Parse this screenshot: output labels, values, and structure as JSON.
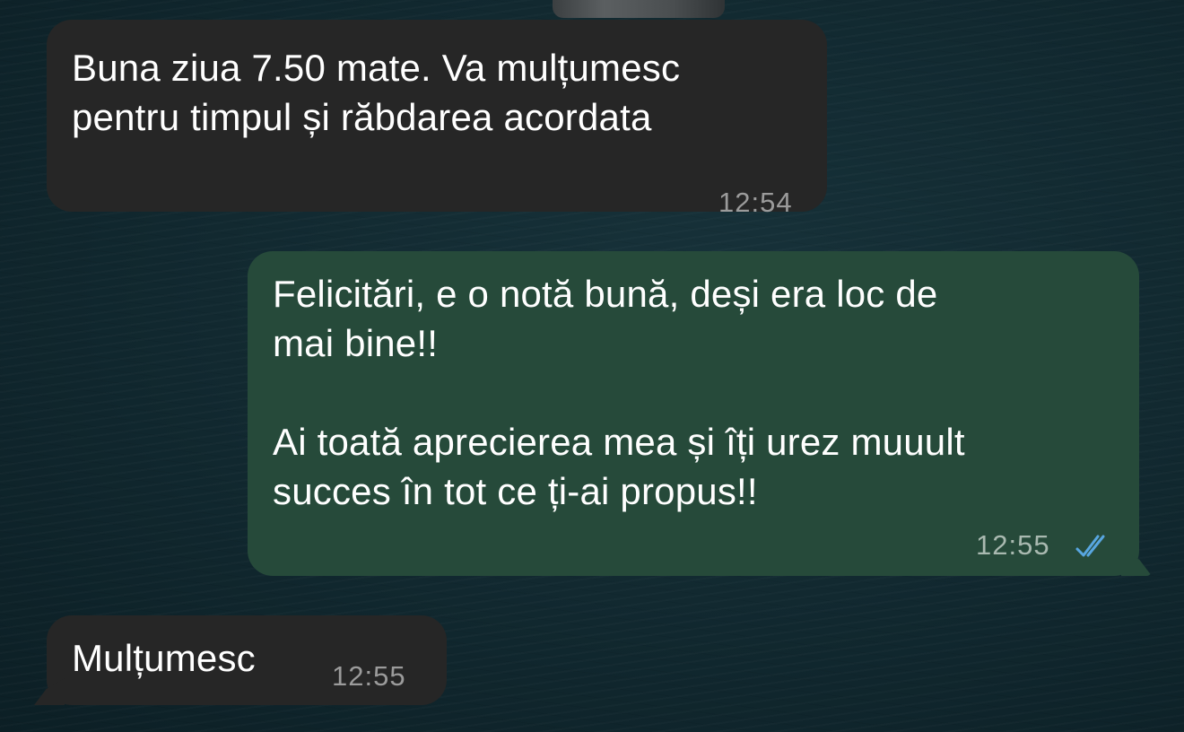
{
  "messages": [
    {
      "direction": "incoming",
      "text": "Buna ziua 7.50 mate. Va mulțumesc\npentru timpul și răbdarea acordata",
      "time": "12:54"
    },
    {
      "direction": "outgoing",
      "text": "Felicitări, e o notă bună, deși era loc de\nmai bine!!\n\nAi toată aprecierea mea și îți urez muuult\nsucces în tot ce ți-ai propus!!",
      "time": "12:55",
      "status": "read",
      "status_icon": "double-check-icon",
      "status_color": "#58a6e0"
    },
    {
      "direction": "incoming",
      "text": "Mulțumesc",
      "time": "12:55"
    }
  ],
  "theme": {
    "incoming_bubble": "#262626",
    "outgoing_bubble": "#264a3a",
    "background": "#11282f"
  }
}
